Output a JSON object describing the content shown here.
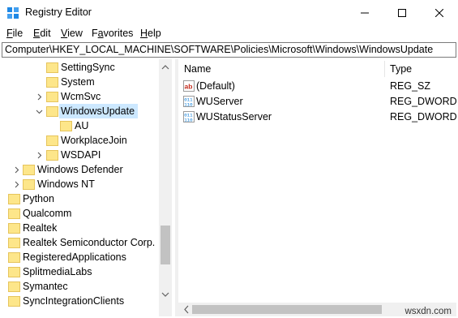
{
  "window": {
    "title": "Registry Editor"
  },
  "menu": [
    "File",
    "Edit",
    "View",
    "Favorites",
    "Help"
  ],
  "menu_underline": [
    "F",
    "E",
    "V",
    "a",
    "H"
  ],
  "address": "Computer\\HKEY_LOCAL_MACHINE\\SOFTWARE\\Policies\\Microsoft\\Windows\\WindowsUpdate",
  "tree": [
    {
      "label": "SettingSync",
      "level": 2,
      "expander": "none"
    },
    {
      "label": "System",
      "level": 2,
      "expander": "none"
    },
    {
      "label": "WcmSvc",
      "level": 2,
      "expander": "collapsed"
    },
    {
      "label": "WindowsUpdate",
      "level": 2,
      "expander": "expanded",
      "selected": true
    },
    {
      "label": "AU",
      "level": 3,
      "expander": "none"
    },
    {
      "label": "WorkplaceJoin",
      "level": 2,
      "expander": "none"
    },
    {
      "label": "WSDAPI",
      "level": 2,
      "expander": "collapsed"
    },
    {
      "label": "Windows Defender",
      "level": 1,
      "expander": "collapsed"
    },
    {
      "label": "Windows NT",
      "level": 1,
      "expander": "collapsed"
    },
    {
      "label": "Python",
      "level": 0,
      "expander": "none"
    },
    {
      "label": "Qualcomm",
      "level": 0,
      "expander": "none"
    },
    {
      "label": "Realtek",
      "level": 0,
      "expander": "none"
    },
    {
      "label": "Realtek Semiconductor Corp.",
      "level": 0,
      "expander": "none"
    },
    {
      "label": "RegisteredApplications",
      "level": 0,
      "expander": "none"
    },
    {
      "label": "SplitmediaLabs",
      "level": 0,
      "expander": "none"
    },
    {
      "label": "Symantec",
      "level": 0,
      "expander": "none"
    },
    {
      "label": "SyncIntegrationClients",
      "level": 0,
      "expander": "none"
    }
  ],
  "columns": {
    "name": "Name",
    "type": "Type"
  },
  "values": [
    {
      "name": "(Default)",
      "type": "REG_SZ",
      "icon": "string-value-icon"
    },
    {
      "name": "WUServer",
      "type": "REG_DWORD",
      "icon": "binary-value-icon"
    },
    {
      "name": "WUStatusServer",
      "type": "REG_DWORD",
      "icon": "binary-value-icon"
    }
  ],
  "watermark": "wsxdn.com",
  "colors": {
    "selection": "#cce8ff",
    "folder": "#fde68a",
    "icon_blue": "#0078d7",
    "icon_red": "#c42b1c"
  }
}
